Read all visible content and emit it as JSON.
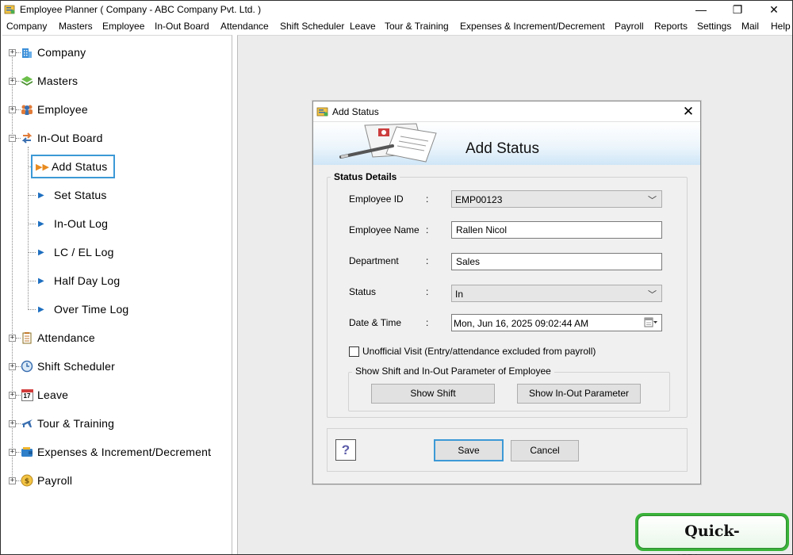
{
  "window": {
    "title": "Employee Planner ( Company - ABC Company Pvt. Ltd. )",
    "controls": {
      "minimize": "—",
      "maximize": "❐",
      "close": "✕"
    }
  },
  "menu": [
    "Company",
    "Masters",
    "Employee",
    "In-Out Board",
    "Attendance",
    "Shift Scheduler",
    "Leave",
    "Tour & Training",
    "Expenses & Increment/Decrement",
    "Payroll",
    "Reports",
    "Settings",
    "Mail",
    "Help"
  ],
  "sidebar": {
    "nodes": [
      {
        "label": "Company",
        "icon": "building-icon"
      },
      {
        "label": "Masters",
        "icon": "layers-icon"
      },
      {
        "label": "Employee",
        "icon": "people-icon"
      },
      {
        "label": "In-Out Board",
        "icon": "swap-arrows-icon"
      },
      {
        "label": "Attendance",
        "icon": "checklist-icon"
      },
      {
        "label": "Shift Scheduler",
        "icon": "clock-icon"
      },
      {
        "label": "Leave",
        "icon": "calendar-icon",
        "icon_text": "17"
      },
      {
        "label": "Tour & Training",
        "icon": "airplane-icon"
      },
      {
        "label": "Expenses & Increment/Decrement",
        "icon": "wallet-icon"
      },
      {
        "label": "Payroll",
        "icon": "coin-icon"
      }
    ],
    "inout_children": [
      {
        "label": "Add Status",
        "selected": true
      },
      {
        "label": "Set Status"
      },
      {
        "label": "In-Out Log"
      },
      {
        "label": "LC / EL Log"
      },
      {
        "label": "Half Day Log"
      },
      {
        "label": "Over Time Log"
      }
    ]
  },
  "dialog": {
    "title": "Add Status",
    "banner_title": "Add Status",
    "group_title": "Status Details",
    "fields": {
      "employee_id": {
        "label": "Employee ID",
        "colon": ":",
        "value": "EMP00123"
      },
      "employee_name": {
        "label": "Employee Name",
        "colon": ":",
        "value": "Rallen Nicol"
      },
      "department": {
        "label": "Department",
        "colon": ":",
        "value": "Sales"
      },
      "status": {
        "label": "Status",
        "colon": ":",
        "value": "In"
      },
      "date_time": {
        "label": "Date & Time",
        "colon": ":",
        "value": "Mon, Jun 16, 2025 09:02:44 AM"
      }
    },
    "unofficial_visit": {
      "label": "Unofficial Visit (Entry/attendance excluded from payroll)",
      "checked": false
    },
    "shift_group_title": "Show Shift and In-Out Parameter of Employee",
    "show_shift_label": "Show Shift",
    "show_inout_label": "Show In-Out Parameter",
    "help_label": "?",
    "save_label": "Save",
    "cancel_label": "Cancel",
    "close_glyph": "✕"
  },
  "watermark": {
    "text": "Quick-Billing.com"
  },
  "colors": {
    "selection_border": "#3c99d6",
    "banner_gradient_end": "#cfe6f7",
    "tree_arrow": "#1e6fc0",
    "watermark_green": "#3ab33a"
  }
}
